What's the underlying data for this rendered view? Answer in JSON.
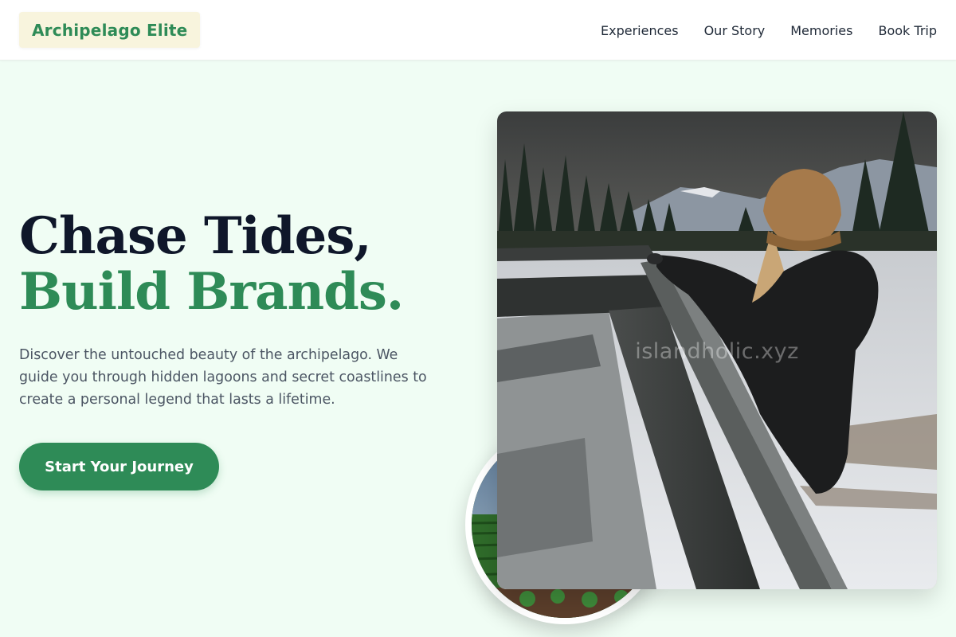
{
  "brand": {
    "name": "Archipelago Elite"
  },
  "nav": {
    "links": [
      "Experiences",
      "Our Story",
      "Memories",
      "Book Trip"
    ]
  },
  "hero": {
    "headline_line1": "Chase Tides,",
    "headline_line2": "Build Brands.",
    "description": "Discover the untouched beauty of the archipelago. We guide you through hidden lagoons and secret coastlines to create a personal legend that lasts a lifetime.",
    "cta_label": "Start Your Journey"
  },
  "images": {
    "main_watermark": "islandholic.xyz"
  },
  "colors": {
    "accent": "#2e8b57",
    "background": "#f0fdf4",
    "heading": "#0f172a",
    "brand_bg": "#f8f4dd"
  }
}
